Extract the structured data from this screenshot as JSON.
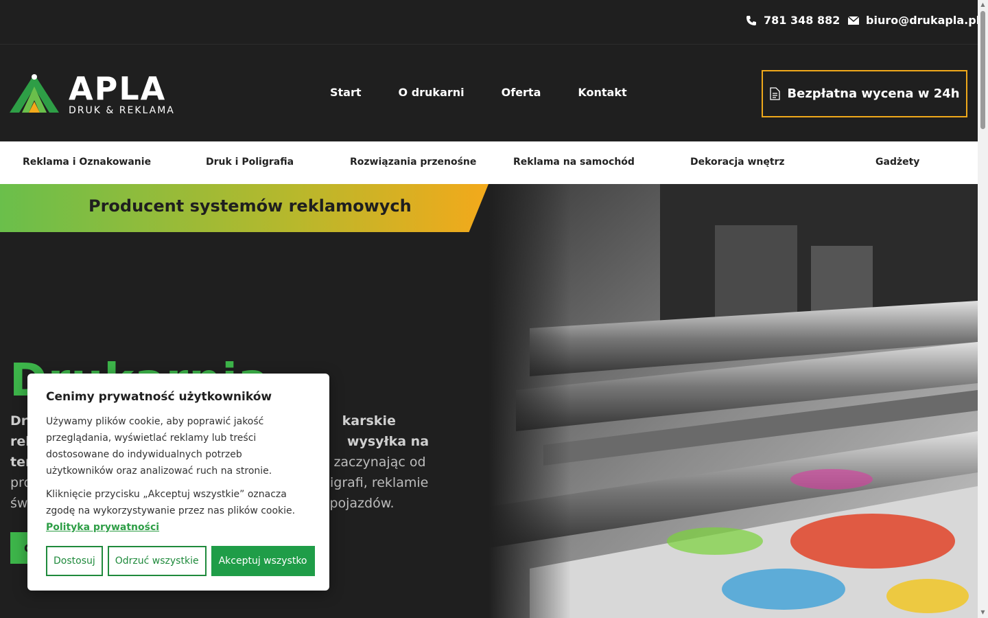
{
  "topbar": {
    "phone": "781 348 882",
    "email": "biuro@drukapla.pl"
  },
  "header": {
    "logo_word": "APLA",
    "logo_sub": "DRUK & REKLAMA",
    "nav": [
      "Start",
      "O drukarni",
      "Oferta",
      "Kontakt"
    ],
    "cta_label": "Bezpłatna wycena w 24h"
  },
  "categories": [
    "Reklama i Oznakowanie",
    "Druk i Poligrafia",
    "Rozwiązania przenośne",
    "Reklama na samochód",
    "Dekoracja wnętrz",
    "Gadżety"
  ],
  "hero": {
    "banner": "Producent systemów reklamowych",
    "title": "Drukarnia",
    "desc_bold_1": "Dru",
    "desc_bold_1b": "karskie",
    "desc_bold_2": "rek",
    "desc_bold_2b": "wysyłka na",
    "desc_bold_3": "ter",
    "desc_3b": "g zaczynając od",
    "desc_4a": "pro",
    "desc_4b": "oligrafi, reklamie",
    "desc_5a": "św",
    "desc_5b": "pojazdów.",
    "button_label": "C"
  },
  "cookie": {
    "title": "Cenimy prywatność użytkowników",
    "text1": "Używamy plików cookie, aby poprawić jakość przeglądania, wyświetlać reklamy lub treści dostosowane do indywidualnych potrzeb użytkowników oraz analizować ruch na stronie.",
    "text2": " Kliknięcie przycisku „Akceptuj wszystkie” oznacza zgodę na wykorzystywanie przez nas plików cookie.",
    "policy_link": "Polityka prywatności",
    "btn_customize": "Dostosuj",
    "btn_reject": "Odrzuć wszystkie",
    "btn_accept": "Akceptuj wszystko"
  },
  "colors": {
    "accent_green": "#3db54a",
    "accent_orange": "#f0a91b",
    "dark_bg": "#1f1f1f"
  }
}
